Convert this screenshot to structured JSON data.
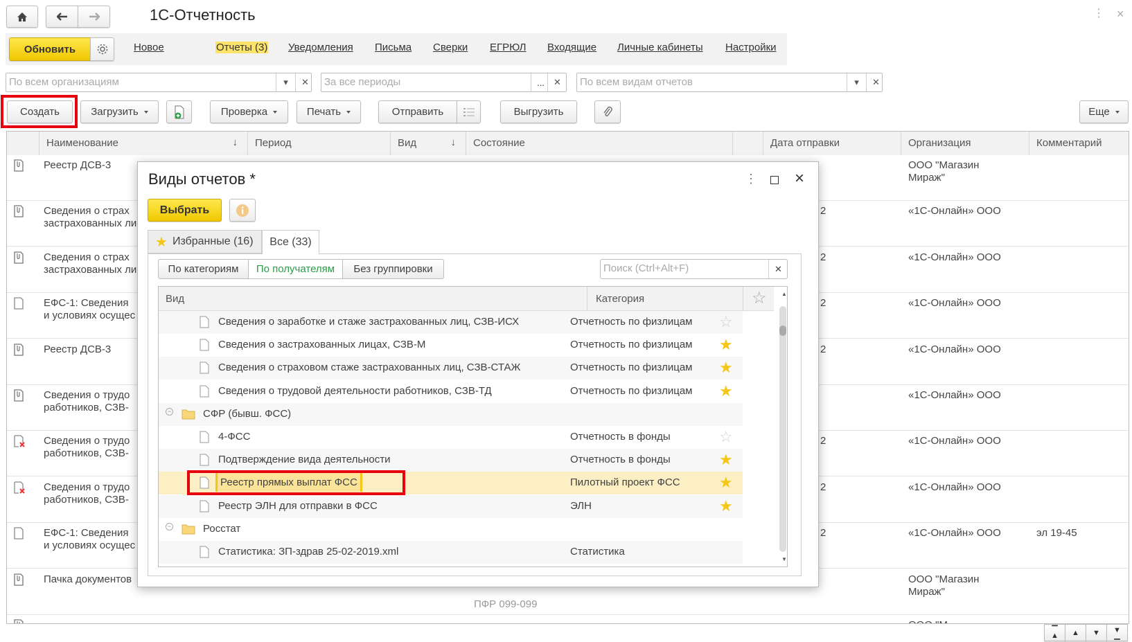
{
  "window": {
    "title": "1С-Отчетность",
    "home_icon": "home-icon",
    "back_icon": "arrow-left-icon",
    "forward_icon": "arrow-right-icon",
    "more_icon": "vertical-dots-icon",
    "close_icon": "close-icon"
  },
  "nav": {
    "refresh_label": "Обновить",
    "items": [
      {
        "label": "Новое",
        "active": false
      },
      {
        "label": "Отчеты (3)",
        "active": true
      },
      {
        "label": "Уведомления",
        "active": false
      },
      {
        "label": "Письма",
        "active": false
      },
      {
        "label": "Сверки",
        "active": false
      },
      {
        "label": "ЕГРЮЛ",
        "active": false
      },
      {
        "label": "Входящие",
        "active": false
      },
      {
        "label": "Личные кабинеты",
        "active": false
      },
      {
        "label": "Настройки",
        "active": false
      }
    ]
  },
  "filters": {
    "organization_placeholder": "По всем организациям",
    "period_placeholder": "За все периоды",
    "report_type_placeholder": "По всем видам отчетов",
    "ellipsis": "..."
  },
  "toolbar": {
    "create": "Создать",
    "upload": "Загрузить",
    "check": "Проверка",
    "print": "Печать",
    "send": "Отправить",
    "export": "Выгрузить",
    "more": "Еще"
  },
  "table": {
    "columns": [
      "Наименование",
      "Период",
      "Вид",
      "Состояние",
      "Дата отправки",
      "Организация",
      "Комментарий"
    ],
    "rows": [
      {
        "icon": "clip",
        "name": "Реестр ДСВ-3",
        "date": "",
        "org": "ООО \"Магазин\nМираж\"",
        "comment": "",
        "state": ""
      },
      {
        "icon": "clip",
        "name": "Сведения о страх\nзастрахованных ли",
        "date": "2",
        "org": "«1С-Онлайн» ООО",
        "comment": "",
        "state": ""
      },
      {
        "icon": "clip",
        "name": "Сведения о страх\nзастрахованных ли",
        "date": "2",
        "org": "«1С-Онлайн» ООО",
        "comment": "",
        "state": ""
      },
      {
        "icon": "doc",
        "name": "ЕФС-1: Сведения\nи условиях осущес",
        "date": "2",
        "org": "«1С-Онлайн» ООО",
        "comment": "",
        "state": ""
      },
      {
        "icon": "clip",
        "name": "Реестр ДСВ-3",
        "date": "2",
        "org": "«1С-Онлайн» ООО",
        "comment": "",
        "state": ""
      },
      {
        "icon": "clip",
        "name": "Сведения о трудо\nработников, СЗВ-",
        "date": "",
        "org": "«1С-Онлайн» ООО",
        "comment": "",
        "state": ""
      },
      {
        "icon": "error",
        "name": "Сведения о трудо\nработников, СЗВ-",
        "date": "2",
        "org": "«1С-Онлайн» ООО",
        "comment": "",
        "state": ""
      },
      {
        "icon": "error",
        "name": "Сведения о трудо\nработников, СЗВ-",
        "date": "2",
        "org": "«1С-Онлайн» ООО",
        "comment": "",
        "state": ""
      },
      {
        "icon": "doc",
        "name": "ЕФС-1: Сведения\nи условиях осущес",
        "date": "2",
        "org": "«1С-Онлайн» ООО",
        "comment": "эл 19-45",
        "state": ""
      },
      {
        "icon": "clip",
        "name": "Пачка документов",
        "date": "",
        "org": "ООО \"Магазин\nМираж\"",
        "comment": "",
        "state": "ПФР 099-099"
      },
      {
        "icon": "clip",
        "name": "",
        "date": "",
        "org": "ООО \"М",
        "comment": "",
        "state": ""
      }
    ]
  },
  "pager": {
    "first_icon": "scroll-top-icon",
    "up_icon": "scroll-up-icon",
    "down_icon": "scroll-down-icon",
    "last_icon": "scroll-bottom-icon"
  },
  "dialog": {
    "title": "Виды отчетов *",
    "select_label": "Выбрать",
    "tabs": [
      {
        "label": "Избранные (16)",
        "active": false
      },
      {
        "label": "Все (33)",
        "active": true
      }
    ],
    "grouping": [
      {
        "label": "По категориям",
        "active": false
      },
      {
        "label": "По получателям",
        "active": true
      },
      {
        "label": "Без группировки",
        "active": false
      }
    ],
    "search_placeholder": "Поиск (Ctrl+Alt+F)",
    "columns": {
      "kind": "Вид",
      "category": "Категория"
    },
    "rows": [
      {
        "type": "item",
        "name": "Сведения о заработке и стаже застрахованных лиц, СЗВ-ИСХ",
        "category": "Отчетность по физлицам",
        "favorite": false
      },
      {
        "type": "item",
        "name": "Сведения о застрахованных лицах, СЗВ-М",
        "category": "Отчетность по физлицам",
        "favorite": true
      },
      {
        "type": "item",
        "name": "Сведения о страховом стаже застрахованных лиц, СЗВ-СТАЖ",
        "category": "Отчетность по физлицам",
        "favorite": true
      },
      {
        "type": "item",
        "name": "Сведения о трудовой деятельности работников, СЗВ-ТД",
        "category": "Отчетность по физлицам",
        "favorite": true
      },
      {
        "type": "group",
        "name": "СФР (бывш. ФСС)"
      },
      {
        "type": "item",
        "name": "4-ФСС",
        "category": "Отчетность в фонды",
        "favorite": false
      },
      {
        "type": "item",
        "name": "Подтверждение вида деятельности",
        "category": "Отчетность в фонды",
        "favorite": true
      },
      {
        "type": "item",
        "name": "Реестр прямых выплат ФСС",
        "category": "Пилотный проект ФСС",
        "favorite": true,
        "selected": true
      },
      {
        "type": "item",
        "name": "Реестр ЭЛН для отправки в ФСС",
        "category": "ЭЛН",
        "favorite": true
      },
      {
        "type": "group",
        "name": "Росстат"
      },
      {
        "type": "item",
        "name": "Статистика: ЗП-здрав 25-02-2019.xml",
        "category": "Статистика",
        "favorite": null
      }
    ]
  },
  "colors": {
    "accent_yellow": "#f5d000",
    "highlight_red": "#e8000b",
    "selected_row": "#fcefc4",
    "star": "#f5c518",
    "active_group": "#2a9d48"
  }
}
